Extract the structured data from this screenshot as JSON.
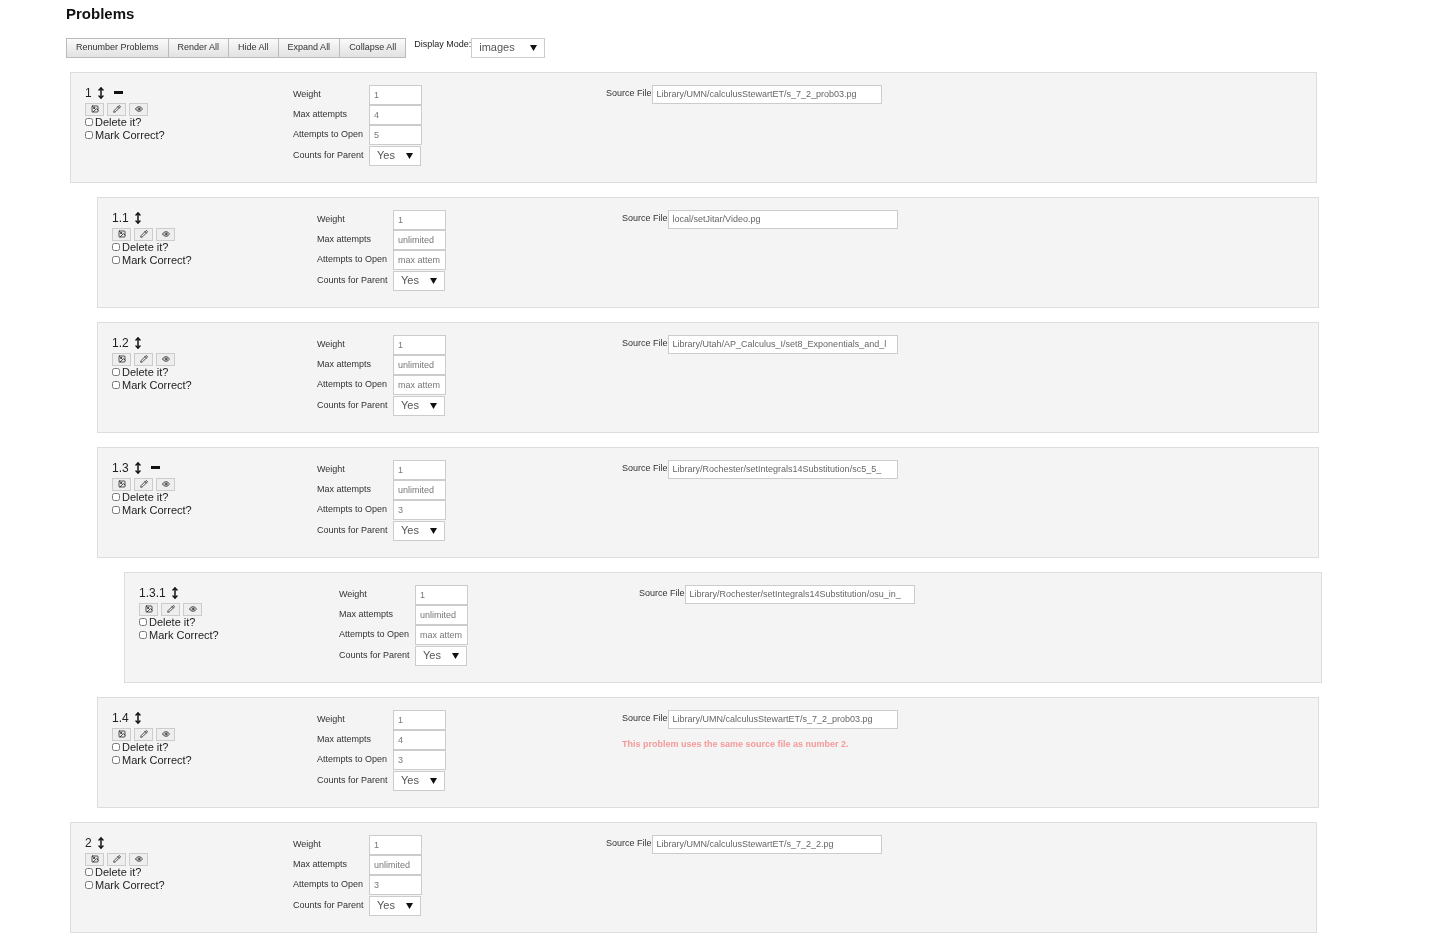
{
  "title": "Problems",
  "toolbar": {
    "buttons": [
      "Renumber Problems",
      "Render All",
      "Hide All",
      "Expand All",
      "Collapse All"
    ],
    "display_mode": {
      "label": "Display Mode:",
      "value": "images"
    }
  },
  "problems": [
    {
      "number": "1",
      "expanded": true,
      "checkboxes": [
        {
          "label": "Delete it?",
          "checked": false
        },
        {
          "label": "Mark Correct?",
          "checked": false
        }
      ],
      "fields": [
        {
          "label": "Weight",
          "value": "1"
        },
        {
          "label": "Max attempts",
          "value": "4"
        },
        {
          "label": "Attempts to Open",
          "value": "5"
        }
      ],
      "counts_for_parent": {
        "label": "Counts for Parent",
        "value": "Yes"
      },
      "source_file": {
        "label": "Source File",
        "value": "Library/UMN/calculusStewartET/s_7_2_prob03.pg"
      },
      "children": [
        {
          "number": "1.1",
          "checkboxes": [
            {
              "label": "Delete it?",
              "checked": false
            },
            {
              "label": "Mark Correct?",
              "checked": false
            }
          ],
          "fields": [
            {
              "label": "Weight",
              "value": "1"
            },
            {
              "label": "Max attempts",
              "value": "unlimited"
            },
            {
              "label": "Attempts to Open",
              "value": "max attem"
            }
          ],
          "counts_for_parent": {
            "label": "Counts for Parent",
            "value": "Yes"
          },
          "source_file": {
            "label": "Source File",
            "value": "local/setJitar/Video.pg"
          }
        },
        {
          "number": "1.2",
          "checkboxes": [
            {
              "label": "Delete it?",
              "checked": false
            },
            {
              "label": "Mark Correct?",
              "checked": false
            }
          ],
          "fields": [
            {
              "label": "Weight",
              "value": "1"
            },
            {
              "label": "Max attempts",
              "value": "unlimited"
            },
            {
              "label": "Attempts to Open",
              "value": "max attem"
            }
          ],
          "counts_for_parent": {
            "label": "Counts for Parent",
            "value": "Yes"
          },
          "source_file": {
            "label": "Source File",
            "value": "Library/Utah/AP_Calculus_I/set8_Exponentials_and_l"
          }
        },
        {
          "number": "1.3",
          "expanded": true,
          "checkboxes": [
            {
              "label": "Delete it?",
              "checked": false
            },
            {
              "label": "Mark Correct?",
              "checked": false
            }
          ],
          "fields": [
            {
              "label": "Weight",
              "value": "1"
            },
            {
              "label": "Max attempts",
              "value": "unlimited"
            },
            {
              "label": "Attempts to Open",
              "value": "3"
            }
          ],
          "counts_for_parent": {
            "label": "Counts for Parent",
            "value": "Yes"
          },
          "source_file": {
            "label": "Source File",
            "value": "Library/Rochester/setIntegrals14Substitution/sc5_5_"
          },
          "children": [
            {
              "number": "1.3.1",
              "checkboxes": [
                {
                  "label": "Delete it?",
                  "checked": false
                },
                {
                  "label": "Mark Correct?",
                  "checked": false
                }
              ],
              "fields": [
                {
                  "label": "Weight",
                  "value": "1"
                },
                {
                  "label": "Max attempts",
                  "value": "unlimited"
                },
                {
                  "label": "Attempts to Open",
                  "value": "max attem"
                }
              ],
              "counts_for_parent": {
                "label": "Counts for Parent",
                "value": "Yes"
              },
              "source_file": {
                "label": "Source File",
                "value": "Library/Rochester/setIntegrals14Substitution/osu_in_"
              }
            }
          ]
        },
        {
          "number": "1.4",
          "checkboxes": [
            {
              "label": "Delete it?",
              "checked": false
            },
            {
              "label": "Mark Correct?",
              "checked": false
            }
          ],
          "fields": [
            {
              "label": "Weight",
              "value": "1"
            },
            {
              "label": "Max attempts",
              "value": "4"
            },
            {
              "label": "Attempts to Open",
              "value": "3"
            }
          ],
          "counts_for_parent": {
            "label": "Counts for Parent",
            "value": "Yes"
          },
          "source_file": {
            "label": "Source File",
            "value": "Library/UMN/calculusStewartET/s_7_2_prob03.pg"
          },
          "warning": "This problem uses the same source file as number 2."
        }
      ]
    },
    {
      "number": "2",
      "checkboxes": [
        {
          "label": "Delete it?",
          "checked": false
        },
        {
          "label": "Mark Correct?",
          "checked": false
        }
      ],
      "fields": [
        {
          "label": "Weight",
          "value": "1"
        },
        {
          "label": "Max attempts",
          "value": "unlimited"
        },
        {
          "label": "Attempts to Open",
          "value": "3"
        }
      ],
      "counts_for_parent": {
        "label": "Counts for Parent",
        "value": "Yes"
      },
      "source_file": {
        "label": "Source File",
        "value": "Library/UMN/calculusStewartET/s_7_2_2.pg"
      }
    }
  ]
}
